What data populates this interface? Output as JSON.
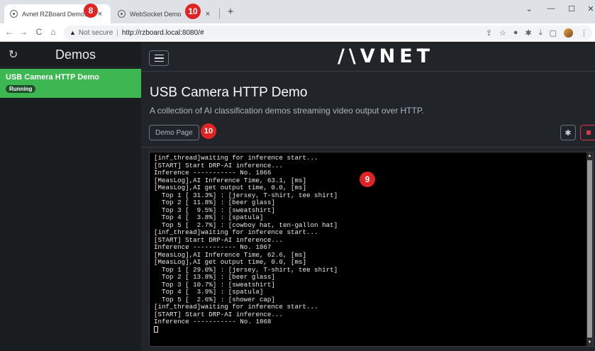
{
  "browser": {
    "tabs": [
      {
        "title": "Avnet RZBoard Demos",
        "close": "×"
      },
      {
        "title": "WebSocket Demo",
        "close": "×"
      }
    ],
    "new_tab": "+",
    "window_controls": {
      "chevron": "⌄",
      "minimize": "—",
      "maximize": "☐",
      "close": "✕"
    },
    "nav": {
      "back": "←",
      "forward": "→",
      "reload": "C",
      "home": "⌂"
    },
    "address": {
      "security_icon": "▲",
      "security_text": "Not secure",
      "divider": "|",
      "url": "http://rzboard.local:8080/#"
    }
  },
  "callouts": {
    "tab_callout": "8",
    "websocket_callout": "10",
    "console_callout": "9",
    "demo_page_callout": "10"
  },
  "sidebar": {
    "refresh_icon": "↻",
    "title": "Demos",
    "items": [
      {
        "name": "USB Camera HTTP Demo",
        "status": "Running"
      }
    ]
  },
  "header": {
    "brand": "/\\VNET",
    "brand_tm": "®"
  },
  "main": {
    "title": "USB Camera HTTP Demo",
    "description": "A collection of AI classification demos streaming video output over HTTP.",
    "demo_page_label": "Demo Page",
    "gear_icon": "✱"
  },
  "console": {
    "lines": [
      "[inf_thread]waiting for inference start...",
      "[START] Start DRP-AI inference...",
      "Inference ----------- No. 1866",
      "[MeasLog],AI Inference Time, 63.1, [ms]",
      "[MeasLog],AI get output time, 0.0, [ms]",
      "  Top 1 [ 31.3%] : [jersey, T-shirt, tee shirt]",
      "  Top 2 [ 11.8%] : [beer glass]",
      "  Top 3 [  9.5%] : [sweatshirt]",
      "  Top 4 [  3.8%] : [spatula]",
      "  Top 5 [  2.7%] : [cowboy hat, ten-gallon hat]",
      "[inf_thread]waiting for inference start...",
      "[START] Start DRP-AI inference...",
      "Inference ----------- No. 1867",
      "[MeasLog],AI Inference Time, 62.6, [ms]",
      "[MeasLog],AI get output time, 0.0, [ms]",
      "  Top 1 [ 29.0%] : [jersey, T-shirt, tee shirt]",
      "  Top 2 [ 13.8%] : [beer glass]",
      "  Top 3 [ 10.7%] : [sweatshirt]",
      "  Top 4 [  3.9%] : [spatula]",
      "  Top 5 [  2.6%] : [shower cap]",
      "[inf_thread]waiting for inference start...",
      "[START] Start DRP-AI inference...",
      "Inference ----------- No. 1868"
    ]
  },
  "colors": {
    "accent_green": "#3cb752",
    "callout_red": "#e02424",
    "stop_red": "#dc3545",
    "app_bg": "#212529"
  }
}
